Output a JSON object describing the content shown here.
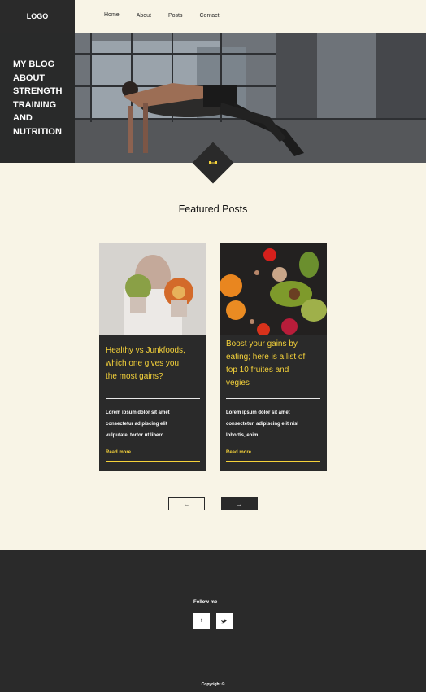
{
  "header": {
    "logo": "LOGO",
    "nav": [
      "Home",
      "About",
      "Posts",
      "Contact"
    ]
  },
  "hero": {
    "title_lines": [
      "MY BLOG",
      "ABOUT",
      "STRENGTH",
      "TRAINING",
      "AND",
      "NUTRITION"
    ],
    "badge_icon": "dumbbell-icon"
  },
  "featured": {
    "title": "Featured Posts",
    "posts": [
      {
        "title_lines": [
          "Healthy vs Junkfoods,",
          "which one gives you",
          "the most gains?"
        ],
        "body_lines": [
          "Lorem ipsum dolor sit amet",
          "consectetur adipiscing elit",
          "vulputate, tortor ut libero"
        ],
        "link": "Read more"
      },
      {
        "title_lines": [
          "Boost your gains by",
          "eating; here is a list of",
          "top 10 fruites and",
          "vegies"
        ],
        "body_lines": [
          "Lorem ipsum dolor sit amet",
          "consectetur, adipiscing elit nisl",
          "lobortis, enim"
        ],
        "link": "Read more"
      }
    ]
  },
  "pager": {
    "prev": "←",
    "next": "→"
  },
  "footer": {
    "follow": "Follow me",
    "socials": [
      "f",
      "▾"
    ],
    "copyright": "Copyright ©"
  },
  "colors": {
    "dark": "#2a2a2a",
    "cream": "#f8f4e6",
    "accent": "#f5d23a"
  }
}
